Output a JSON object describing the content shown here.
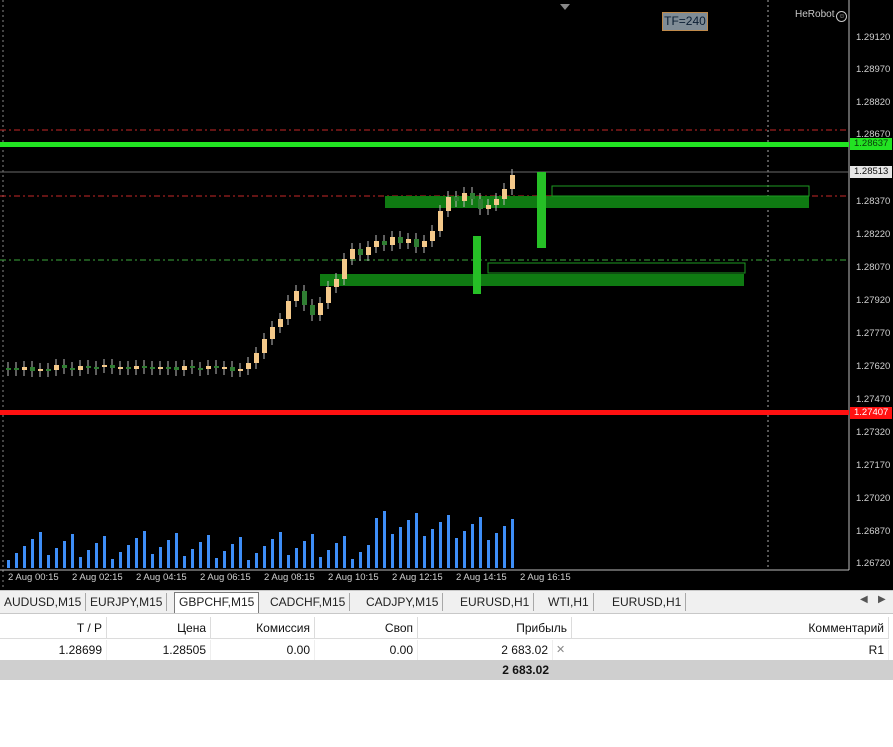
{
  "chart": {
    "tf_label": "TF=240",
    "brand": "HeRobot",
    "brand_icon": "smile-icon",
    "y_ticks": [
      "1.29120",
      "1.28970",
      "1.28820",
      "1.28670",
      "1.28370",
      "1.28220",
      "1.28070",
      "1.27920",
      "1.27770",
      "1.27620",
      "1.27470",
      "1.27320",
      "1.27170",
      "1.27020",
      "1.26870",
      "1.26720"
    ],
    "y_tag_green": "1.28637",
    "y_tag_gray": "1.28513",
    "y_tag_red": "1.27407",
    "x_ticks": [
      "2 Aug 00:15",
      "2 Aug 02:15",
      "2 Aug 04:15",
      "2 Aug 06:15",
      "2 Aug 08:15",
      "2 Aug 10:15",
      "2 Aug 12:15",
      "2 Aug 14:15",
      "2 Aug 16:15"
    ],
    "colors": {
      "bull": "#f4c98a",
      "bear": "#2f7d32",
      "volume": "#3e8ef7",
      "green_line": "#22e322",
      "red_line": "#ff1111",
      "zone": "#0f7a12"
    }
  },
  "tabs": {
    "items": [
      "AUDUSD,M15",
      "EURJPY,M15",
      "GBPCHF,M15",
      "CADCHF,M15",
      "CADJPY,M15",
      "EURUSD,H1",
      "WTI,H1",
      "EURUSD,H1"
    ],
    "active": "GBPCHF,M15",
    "prev_icon": "triangle-left-icon",
    "next_icon": "triangle-right-icon"
  },
  "table": {
    "headers": {
      "tp": "T / P",
      "price": "Цена",
      "commission": "Комиссия",
      "swap": "Своп",
      "profit": "Прибыль",
      "comment": "Комментарий"
    },
    "row": {
      "tp": "1.28699",
      "price": "1.28505",
      "commission": "0.00",
      "swap": "0.00",
      "profit": "2 683.02",
      "comment": "R1"
    },
    "close_icon": "close-icon",
    "total": "2 683.02"
  }
}
